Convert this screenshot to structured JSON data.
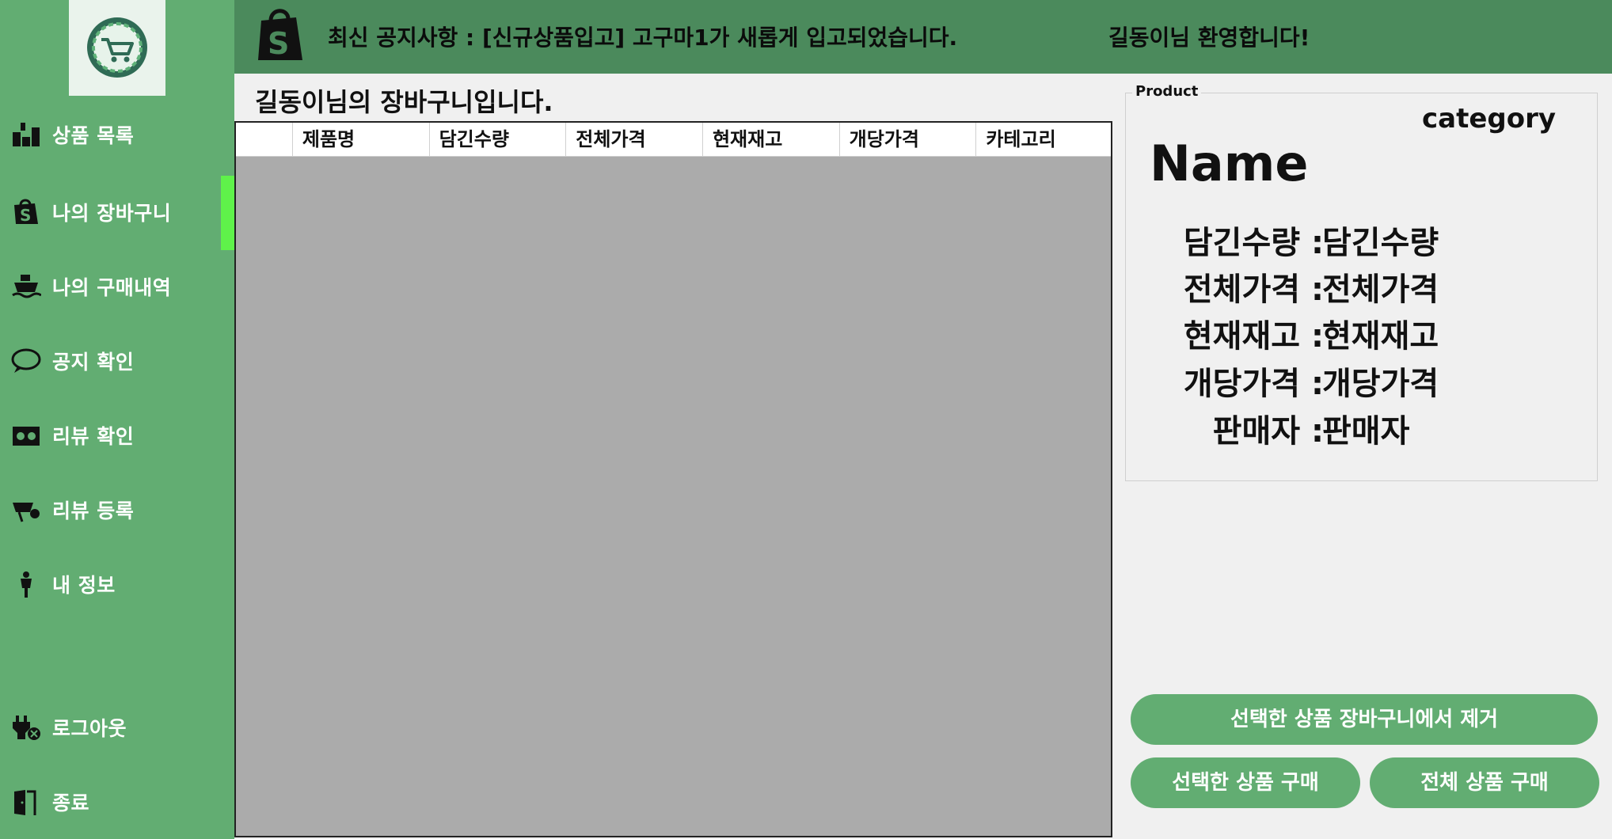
{
  "header": {
    "notice": "최신 공지사항 : [신규상품입고] 고구마1가 새롭게 입고되었습니다.",
    "welcome": "길동이님 환영합니다!"
  },
  "sidebar": {
    "items": [
      {
        "label": "상품 목록",
        "icon": "boxes-icon"
      },
      {
        "label": "나의 장바구니",
        "icon": "shopping-bag-icon"
      },
      {
        "label": "나의 구매내역",
        "icon": "ship-icon"
      },
      {
        "label": "공지 확인",
        "icon": "speech-bubble-icon"
      },
      {
        "label": "리뷰 확인",
        "icon": "review-icon"
      },
      {
        "label": "리뷰 등록",
        "icon": "review-write-icon"
      },
      {
        "label": "내 정보",
        "icon": "person-icon"
      },
      {
        "label": "로그아웃",
        "icon": "plug-icon"
      },
      {
        "label": "종료",
        "icon": "exit-door-icon"
      }
    ],
    "active_index": 1
  },
  "main": {
    "title": "길동이님의 장바구니입니다.",
    "table": {
      "columns": [
        "",
        "제품명",
        "담긴수량",
        "전체가격",
        "현재재고",
        "개당가격",
        "카테고리"
      ],
      "rows": []
    }
  },
  "product": {
    "legend": "Product",
    "category": "category",
    "name": "Name",
    "details": [
      {
        "key": "담긴수량 :",
        "value": "담긴수량"
      },
      {
        "key": "전체가격 :",
        "value": "전체가격"
      },
      {
        "key": "현재재고 :",
        "value": "현재재고"
      },
      {
        "key": "개당가격 :",
        "value": "개당가격"
      },
      {
        "key": "판매자 :",
        "value": "판매자"
      }
    ]
  },
  "buttons": {
    "remove_selected": "선택한 상품 장바구니에서 제거",
    "buy_selected": "선택한 상품 구매",
    "buy_all": "전체 상품 구매"
  },
  "colors": {
    "sidebar": "#62ad72",
    "header": "#4b8a5c",
    "active_indicator": "#5ff24a",
    "table_body": "#ababab"
  }
}
